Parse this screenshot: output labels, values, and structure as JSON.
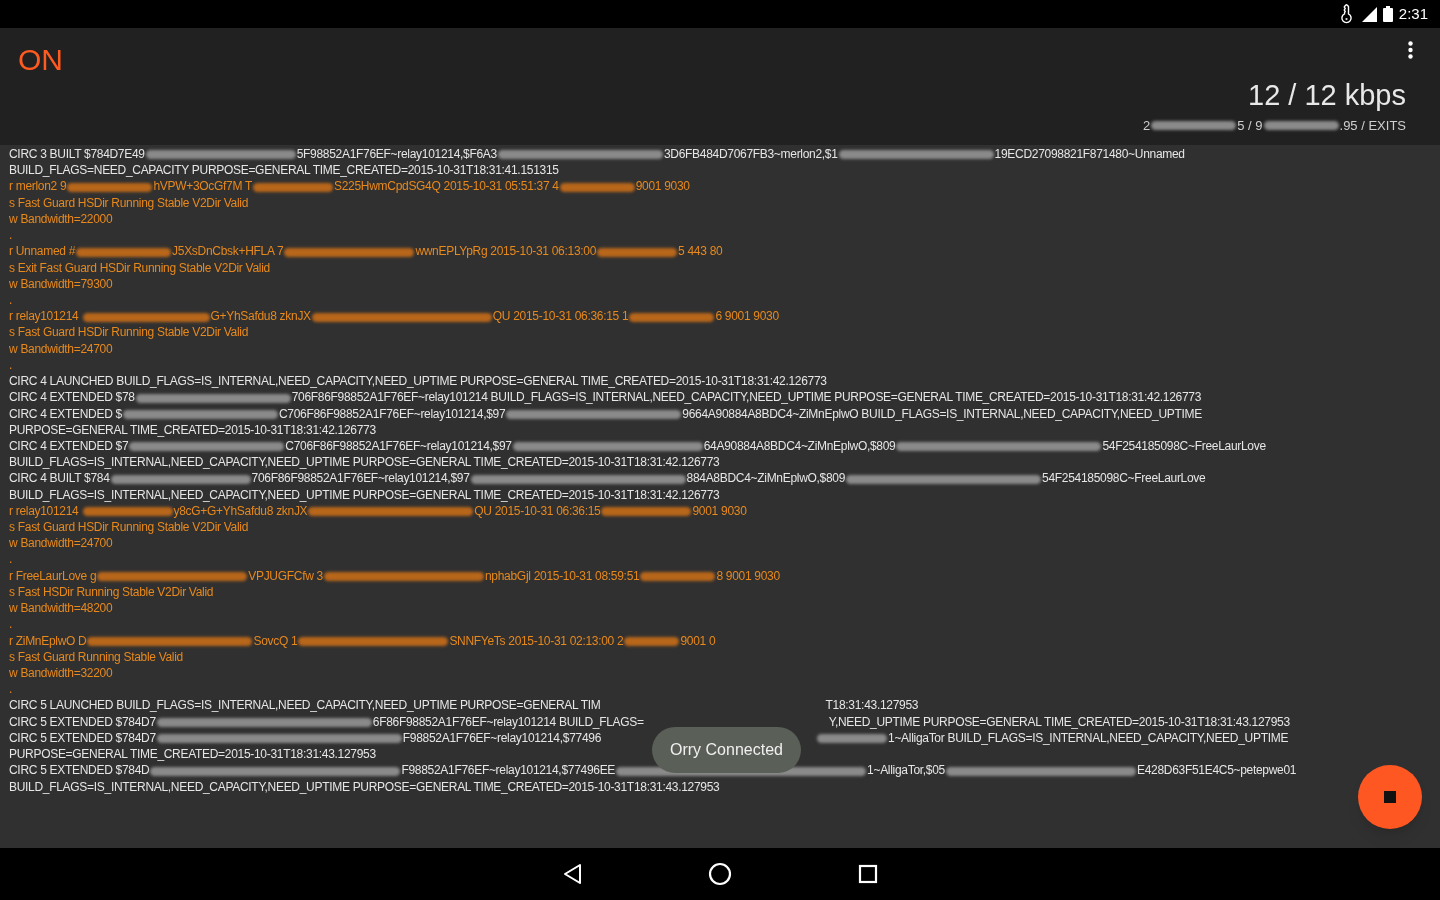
{
  "status_bar": {
    "time": "2:31"
  },
  "header": {
    "state": "ON",
    "rate": "12 / 12 kbps",
    "relays": [
      {
        "kind": "text",
        "text": "2"
      },
      {
        "kind": "redacted"
      },
      {
        "kind": "text",
        "text": "5 / 9"
      },
      {
        "kind": "redacted"
      },
      {
        "kind": "text",
        "text": ".95 / EXITS"
      }
    ]
  },
  "log": [
    {
      "kind": "circuit",
      "segments": [
        {
          "kind": "text",
          "text": "CIRC 3 BUILT $784D7E49"
        },
        {
          "kind": "redacted"
        },
        {
          "kind": "text",
          "text": "5F98852A1F76EF~relay101214,$F6A3"
        },
        {
          "kind": "redacted"
        },
        {
          "kind": "text",
          "text": "3D6FB484D7067FB3~merlon2,$1"
        },
        {
          "kind": "redacted"
        },
        {
          "kind": "text",
          "text": "19ECD27098821F871480~Unnamed"
        }
      ]
    },
    {
      "kind": "circuit",
      "segments": [
        {
          "kind": "text",
          "text": "BUILD_FLAGS=NEED_CAPACITY PURPOSE=GENERAL TIME_CREATED=2015-10-31T18:31:41.151315"
        }
      ]
    },
    {
      "kind": "relay",
      "segments": [
        {
          "kind": "text",
          "text": "r merlon2 9"
        },
        {
          "kind": "redacted"
        },
        {
          "kind": "text",
          "text": "hVPW+3OcGf7M T"
        },
        {
          "kind": "redacted"
        },
        {
          "kind": "text",
          "text": "S225HwmCpdSG4Q 2015-10-31 05:51:37 4"
        },
        {
          "kind": "redacted"
        },
        {
          "kind": "text",
          "text": "9001 9030"
        }
      ]
    },
    {
      "kind": "relay",
      "segments": [
        {
          "kind": "text",
          "text": "s Fast Guard HSDir Running Stable V2Dir Valid"
        }
      ]
    },
    {
      "kind": "relay",
      "segments": [
        {
          "kind": "text",
          "text": "w Bandwidth=22000"
        }
      ]
    },
    {
      "kind": "relay",
      "segments": [
        {
          "kind": "text",
          "text": "."
        }
      ]
    },
    {
      "kind": "relay",
      "segments": [
        {
          "kind": "text",
          "text": "r Unnamed #"
        },
        {
          "kind": "redacted"
        },
        {
          "kind": "text",
          "text": "J5XsDnCbsk+HFLA 7"
        },
        {
          "kind": "redacted"
        },
        {
          "kind": "text",
          "text": "wwnEPLYpRg 2015-10-31 06:13:00"
        },
        {
          "kind": "redacted"
        },
        {
          "kind": "text",
          "text": "5 443 80"
        }
      ]
    },
    {
      "kind": "relay",
      "segments": [
        {
          "kind": "text",
          "text": "s Exit Fast Guard HSDir Running Stable V2Dir Valid"
        }
      ]
    },
    {
      "kind": "relay",
      "segments": [
        {
          "kind": "text",
          "text": "w Bandwidth=79300"
        }
      ]
    },
    {
      "kind": "relay",
      "segments": [
        {
          "kind": "text",
          "text": "."
        }
      ]
    },
    {
      "kind": "relay",
      "segments": [
        {
          "kind": "text",
          "text": "r relay101214 "
        },
        {
          "kind": "redacted"
        },
        {
          "kind": "text",
          "text": "G+YhSafdu8 zknJX"
        },
        {
          "kind": "redacted"
        },
        {
          "kind": "text",
          "text": "QU 2015-10-31 06:36:15 1"
        },
        {
          "kind": "redacted"
        },
        {
          "kind": "text",
          "text": "6 9001 9030"
        }
      ]
    },
    {
      "kind": "relay",
      "segments": [
        {
          "kind": "text",
          "text": "s Fast Guard HSDir Running Stable V2Dir Valid"
        }
      ]
    },
    {
      "kind": "relay",
      "segments": [
        {
          "kind": "text",
          "text": "w Bandwidth=24700"
        }
      ]
    },
    {
      "kind": "relay",
      "segments": [
        {
          "kind": "text",
          "text": "."
        }
      ]
    },
    {
      "kind": "circuit",
      "segments": [
        {
          "kind": "text",
          "text": "CIRC 4 LAUNCHED BUILD_FLAGS=IS_INTERNAL,NEED_CAPACITY,NEED_UPTIME PURPOSE=GENERAL TIME_CREATED=2015-10-31T18:31:42.126773"
        }
      ]
    },
    {
      "kind": "circuit",
      "segments": [
        {
          "kind": "text",
          "text": "CIRC 4 EXTENDED $78"
        },
        {
          "kind": "redacted"
        },
        {
          "kind": "text",
          "text": "706F86F98852A1F76EF~relay101214 BUILD_FLAGS=IS_INTERNAL,NEED_CAPACITY,NEED_UPTIME PURPOSE=GENERAL TIME_CREATED=2015-10-31T18:31:42.126773"
        }
      ]
    },
    {
      "kind": "circuit",
      "segments": [
        {
          "kind": "text",
          "text": "CIRC 4 EXTENDED $"
        },
        {
          "kind": "redacted"
        },
        {
          "kind": "text",
          "text": "C706F86F98852A1F76EF~relay101214,$97"
        },
        {
          "kind": "redacted"
        },
        {
          "kind": "text",
          "text": "9664A90884A8BDC4~ZiMnEplwO BUILD_FLAGS=IS_INTERNAL,NEED_CAPACITY,NEED_UPTIME"
        }
      ]
    },
    {
      "kind": "circuit",
      "segments": [
        {
          "kind": "text",
          "text": "PURPOSE=GENERAL TIME_CREATED=2015-10-31T18:31:42.126773"
        }
      ]
    },
    {
      "kind": "circuit",
      "segments": [
        {
          "kind": "text",
          "text": "CIRC 4 EXTENDED $7"
        },
        {
          "kind": "redacted"
        },
        {
          "kind": "text",
          "text": "C706F86F98852A1F76EF~relay101214,$97"
        },
        {
          "kind": "redacted"
        },
        {
          "kind": "text",
          "text": "64A90884A8BDC4~ZiMnEplwO,$809"
        },
        {
          "kind": "redacted"
        },
        {
          "kind": "text",
          "text": "54F254185098C~FreeLaurLove"
        }
      ]
    },
    {
      "kind": "circuit",
      "segments": [
        {
          "kind": "text",
          "text": "BUILD_FLAGS=IS_INTERNAL,NEED_CAPACITY,NEED_UPTIME PURPOSE=GENERAL TIME_CREATED=2015-10-31T18:31:42.126773"
        }
      ]
    },
    {
      "kind": "circuit",
      "segments": [
        {
          "kind": "text",
          "text": "CIRC 4 BUILT $784"
        },
        {
          "kind": "redacted"
        },
        {
          "kind": "text",
          "text": "706F86F98852A1F76EF~relay101214,$97"
        },
        {
          "kind": "redacted"
        },
        {
          "kind": "text",
          "text": "884A8BDC4~ZiMnEplwO,$809"
        },
        {
          "kind": "redacted"
        },
        {
          "kind": "text",
          "text": "54F254185098C~FreeLaurLove"
        }
      ]
    },
    {
      "kind": "circuit",
      "segments": [
        {
          "kind": "text",
          "text": "BUILD_FLAGS=IS_INTERNAL,NEED_CAPACITY,NEED_UPTIME PURPOSE=GENERAL TIME_CREATED=2015-10-31T18:31:42.126773"
        }
      ]
    },
    {
      "kind": "relay",
      "segments": [
        {
          "kind": "text",
          "text": "r relay101214 "
        },
        {
          "kind": "redacted"
        },
        {
          "kind": "text",
          "text": "y8cG+G+YhSafdu8 zknJX"
        },
        {
          "kind": "redacted"
        },
        {
          "kind": "text",
          "text": "QU 2015-10-31 06:36:15"
        },
        {
          "kind": "redacted"
        },
        {
          "kind": "text",
          "text": "9001 9030"
        }
      ]
    },
    {
      "kind": "relay",
      "segments": [
        {
          "kind": "text",
          "text": "s Fast Guard HSDir Running Stable V2Dir Valid"
        }
      ]
    },
    {
      "kind": "relay",
      "segments": [
        {
          "kind": "text",
          "text": "w Bandwidth=24700"
        }
      ]
    },
    {
      "kind": "relay",
      "segments": [
        {
          "kind": "text",
          "text": "."
        }
      ]
    },
    {
      "kind": "relay",
      "segments": [
        {
          "kind": "text",
          "text": "r FreeLaurLove g"
        },
        {
          "kind": "redacted"
        },
        {
          "kind": "text",
          "text": "VPJUGFCfw 3"
        },
        {
          "kind": "redacted"
        },
        {
          "kind": "text",
          "text": "nphabGjl 2015-10-31 08:59:51"
        },
        {
          "kind": "redacted"
        },
        {
          "kind": "text",
          "text": "8 9001 9030"
        }
      ]
    },
    {
      "kind": "relay",
      "segments": [
        {
          "kind": "text",
          "text": "s Fast HSDir Running Stable V2Dir Valid"
        }
      ]
    },
    {
      "kind": "relay",
      "segments": [
        {
          "kind": "text",
          "text": "w Bandwidth=48200"
        }
      ]
    },
    {
      "kind": "relay",
      "segments": [
        {
          "kind": "text",
          "text": "."
        }
      ]
    },
    {
      "kind": "relay",
      "segments": [
        {
          "kind": "text",
          "text": "r ZiMnEplwO D"
        },
        {
          "kind": "redacted"
        },
        {
          "kind": "text",
          "text": "SovcQ 1"
        },
        {
          "kind": "redacted"
        },
        {
          "kind": "text",
          "text": "SNNFYeTs 2015-10-31 02:13:00 2"
        },
        {
          "kind": "redacted"
        },
        {
          "kind": "text",
          "text": "9001 0"
        }
      ]
    },
    {
      "kind": "relay",
      "segments": [
        {
          "kind": "text",
          "text": "s Fast Guard Running Stable Valid"
        }
      ]
    },
    {
      "kind": "relay",
      "segments": [
        {
          "kind": "text",
          "text": "w Bandwidth=32200"
        }
      ]
    },
    {
      "kind": "relay",
      "segments": [
        {
          "kind": "text",
          "text": "."
        }
      ]
    },
    {
      "kind": "circuit",
      "segments": [
        {
          "kind": "text",
          "text": "CIRC 5 LAUNCHED BUILD_FLAGS=IS_INTERNAL,NEED_CAPACITY,NEED_UPTIME PURPOSE=GENERAL TIM"
        },
        {
          "kind": "covered"
        },
        {
          "kind": "text",
          "text": "T18:31:43.127953"
        }
      ]
    },
    {
      "kind": "circuit",
      "segments": [
        {
          "kind": "text",
          "text": "CIRC 5 EXTENDED $784D7"
        },
        {
          "kind": "redacted"
        },
        {
          "kind": "text",
          "text": "6F86F98852A1F76EF~relay101214 BUILD_FLAGS="
        },
        {
          "kind": "covered"
        },
        {
          "kind": "text",
          "text": "Y,NEED_UPTIME PURPOSE=GENERAL TIME_CREATED=2015-10-31T18:31:43.127953"
        }
      ]
    },
    {
      "kind": "circuit",
      "segments": [
        {
          "kind": "text",
          "text": "CIRC 5 EXTENDED $784D7"
        },
        {
          "kind": "redacted"
        },
        {
          "kind": "text",
          "text": "F98852A1F76EF~relay101214,$77496"
        },
        {
          "kind": "covered"
        },
        {
          "kind": "redacted"
        },
        {
          "kind": "text",
          "text": "1~AlligaTor BUILD_FLAGS=IS_INTERNAL,NEED_CAPACITY,NEED_UPTIME"
        }
      ]
    },
    {
      "kind": "circuit",
      "segments": [
        {
          "kind": "text",
          "text": "PURPOSE=GENERAL TIME_CREATED=2015-10-31T18:31:43.127953"
        }
      ]
    },
    {
      "kind": "circuit",
      "segments": [
        {
          "kind": "text",
          "text": "CIRC 5 EXTENDED $784D"
        },
        {
          "kind": "redacted"
        },
        {
          "kind": "text",
          "text": "F98852A1F76EF~relay101214,$77496EE"
        },
        {
          "kind": "redacted"
        },
        {
          "kind": "text",
          "text": "1~AlligaTor,$05"
        },
        {
          "kind": "redacted"
        },
        {
          "kind": "text",
          "text": "E428D63F51E4C5~petepwe01"
        }
      ]
    },
    {
      "kind": "circuit",
      "segments": [
        {
          "kind": "text",
          "text": "BUILD_FLAGS=IS_INTERNAL,NEED_CAPACITY,NEED_UPTIME PURPOSE=GENERAL TIME_CREATED=2015-10-31T18:31:43.127953"
        }
      ]
    }
  ],
  "toast": "Orry Connected"
}
